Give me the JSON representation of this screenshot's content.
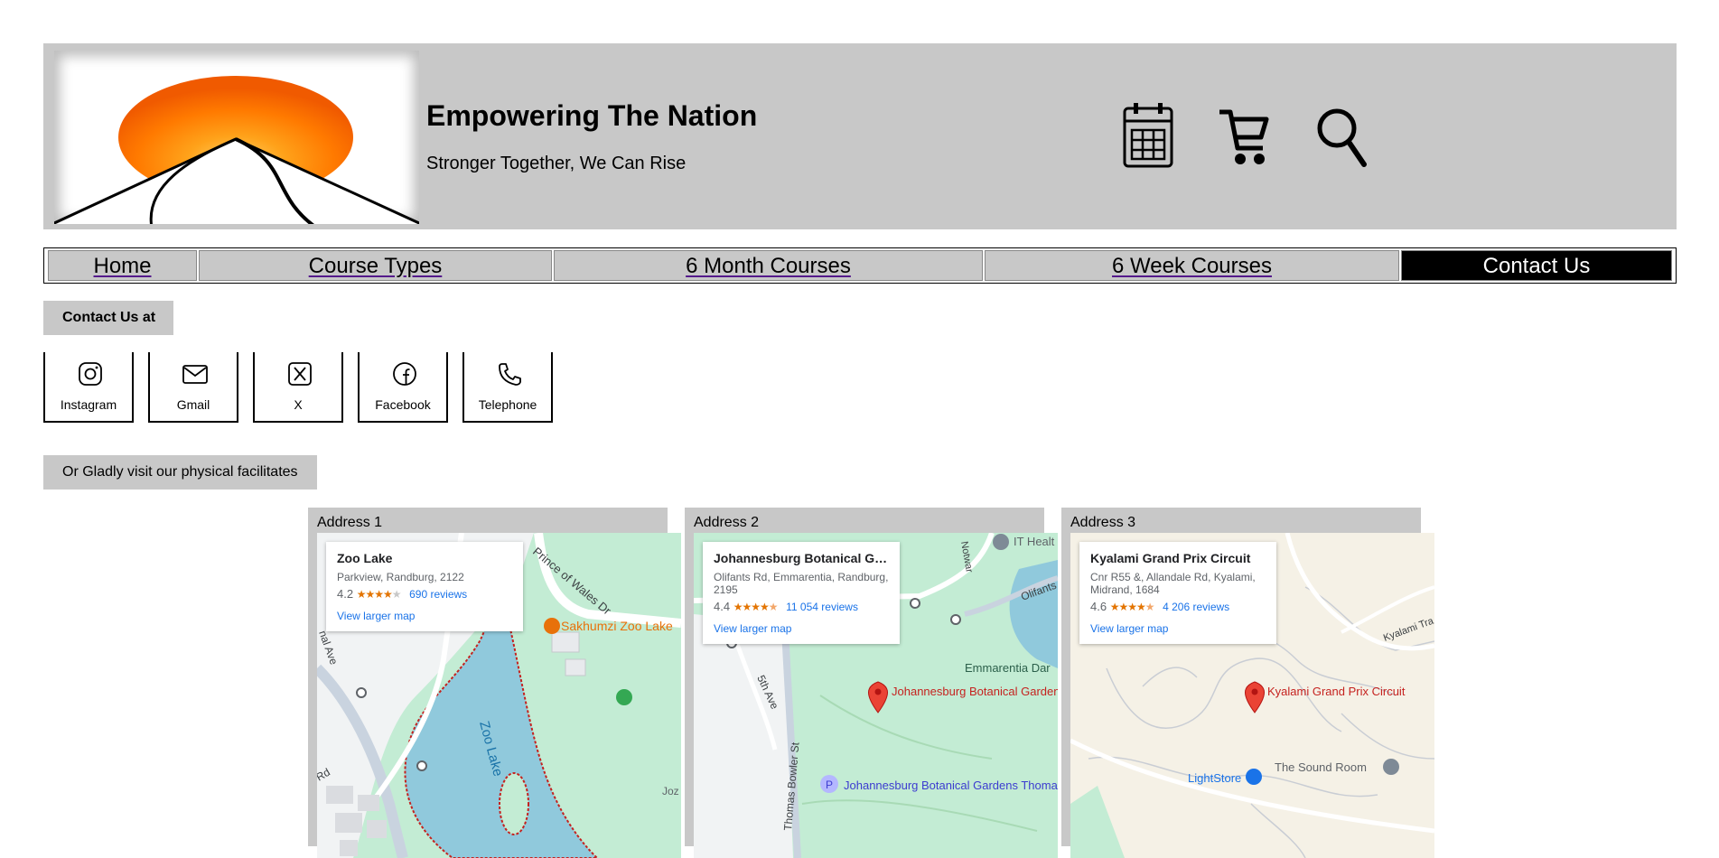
{
  "header": {
    "title": "Empowering The Nation",
    "subtitle": "Stronger Together, We Can Rise",
    "icons": [
      "calendar-icon",
      "cart-icon",
      "search-icon"
    ]
  },
  "nav": {
    "items": [
      {
        "label": "Home",
        "active": false
      },
      {
        "label": "Course Types",
        "active": false
      },
      {
        "label": "6 Month Courses",
        "active": false
      },
      {
        "label": "6 Week Courses",
        "active": false
      },
      {
        "label": "Contact Us",
        "active": true
      }
    ]
  },
  "contact": {
    "heading": "Contact Us at",
    "socials": [
      {
        "label": "Instagram",
        "icon": "instagram-icon"
      },
      {
        "label": "Gmail",
        "icon": "gmail-icon"
      },
      {
        "label": "X",
        "icon": "x-icon"
      },
      {
        "label": "Facebook",
        "icon": "facebook-icon"
      },
      {
        "label": "Telephone",
        "icon": "telephone-icon"
      }
    ],
    "visit_text": "Or Gladly visit our physical facilitates"
  },
  "addresses": [
    {
      "label": "Address 1",
      "place": "Zoo Lake",
      "address": "Parkview, Randburg, 2122",
      "rating": "4.2",
      "reviews": "690 reviews",
      "larger_map": "View larger map",
      "map_labels": {
        "poi": "Sakhumzi Zoo Lake",
        "water": "Zoo Lake",
        "road": "Prince of Wales Dr",
        "road2": "Rd",
        "road3": "nal Ave",
        "edge": "Joz"
      }
    },
    {
      "label": "Address 2",
      "place": "Johannesburg Botanical Gard...",
      "address": "Olifants Rd, Emmarentia, Randburg, 2195",
      "rating": "4.4",
      "reviews": "11 054 reviews",
      "larger_map": "View larger map",
      "map_labels": {
        "pin": "Johannesburg Botanical Gardens",
        "parking": "Johannesburg Botanical Gardens Thomas...",
        "area": "Emmarentia Dar",
        "road": "5th Ave",
        "road2": "Thomas Bowler St",
        "road3": "Olifants",
        "poi": "IT Healt",
        "road4": "Notwar"
      }
    },
    {
      "label": "Address 3",
      "place": "Kyalami Grand Prix Circuit",
      "address": "Cnr R55 &, Allandale Rd, Kyalami, Midrand, 1684",
      "rating": "4.6",
      "reviews": "4 206 reviews",
      "larger_map": "View larger map",
      "map_labels": {
        "pin": "Kyalami Grand Prix Circuit",
        "shop": "LightStore",
        "poi": "The Sound Room",
        "road": "Kyalami Tra"
      }
    }
  ],
  "colors": {
    "panel": "#c8c8c8",
    "sun_orange": "#ff6a00",
    "map_green": "#c3ecd4",
    "map_water": "#90c9dc",
    "pin_red": "#ea4335",
    "link_blue": "#1a73e8"
  }
}
